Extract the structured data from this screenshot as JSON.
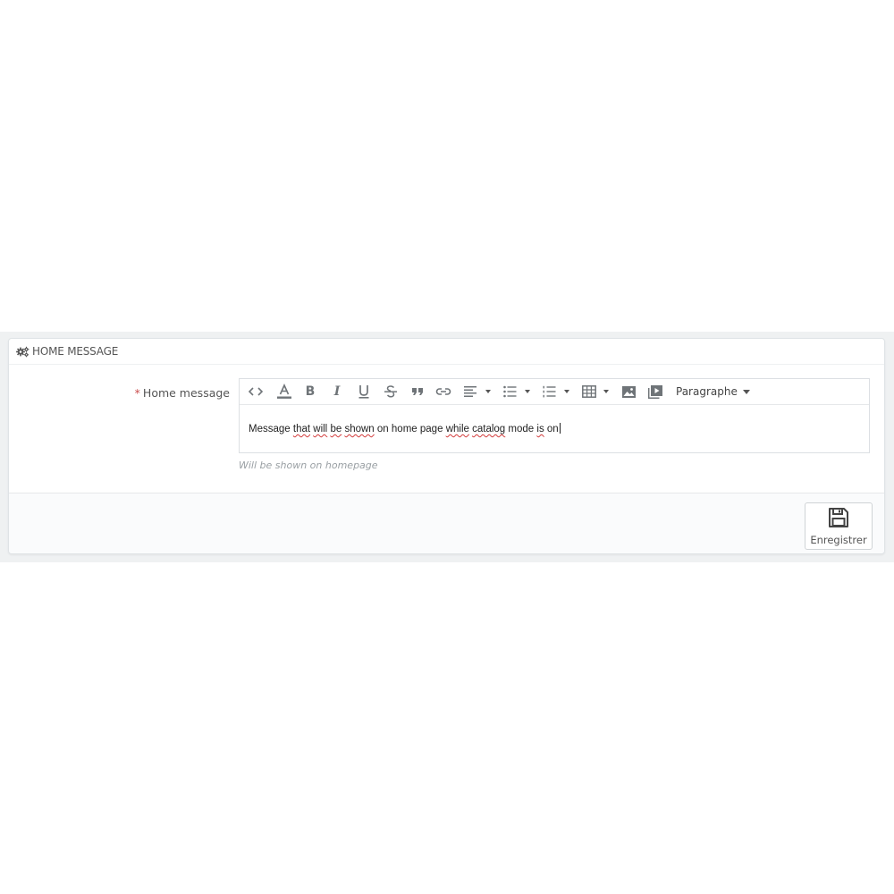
{
  "panel": {
    "title": "HOME MESSAGE",
    "title_icon": "cogs-icon"
  },
  "form": {
    "field_required_mark": "*",
    "field_label": "Home message",
    "help_text": "Will be shown on homepage",
    "editor": {
      "toolbar": [
        {
          "name": "code-view-icon"
        },
        {
          "name": "text-color-icon"
        },
        {
          "name": "bold-icon"
        },
        {
          "name": "italic-icon"
        },
        {
          "name": "underline-icon"
        },
        {
          "name": "strikethrough-icon"
        },
        {
          "name": "blockquote-icon"
        },
        {
          "name": "link-icon"
        },
        {
          "name": "align-left-icon",
          "dropdown": true
        },
        {
          "name": "bullet-list-icon",
          "dropdown": true
        },
        {
          "name": "numbered-list-icon",
          "dropdown": true
        },
        {
          "name": "table-icon",
          "dropdown": true
        },
        {
          "name": "image-icon"
        },
        {
          "name": "media-icon"
        }
      ],
      "format_select_label": "Paragraphe",
      "content_words": [
        "Message",
        "that",
        "will",
        "be",
        "shown",
        "on",
        "home",
        "page",
        "while",
        "catalog",
        "mode",
        "is",
        "on"
      ],
      "misspelled": [
        "that",
        "will",
        "be",
        "shown",
        "while",
        "catalog",
        "is"
      ]
    }
  },
  "footer": {
    "save_label": "Enregistrer",
    "save_icon": "floppy-disk-icon"
  },
  "colors": {
    "required": "#c94b4b",
    "spell_error": "#d23a3a",
    "panel_bg": "#ffffff",
    "band_bg": "#eff1f2"
  }
}
